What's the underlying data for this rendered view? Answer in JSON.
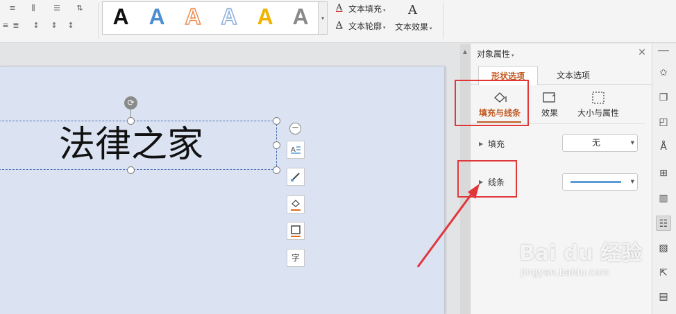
{
  "ribbon": {
    "text_styles": [
      {
        "glyph": "A",
        "name": "text-style-black",
        "color": "#111111"
      },
      {
        "glyph": "A",
        "name": "text-style-blue",
        "color": "#4f8fd1"
      },
      {
        "glyph": "A",
        "name": "text-style-orange-outline",
        "color": "#ee8a4a"
      },
      {
        "glyph": "A",
        "name": "text-style-blue-outline",
        "color": "#8aaedb"
      },
      {
        "glyph": "A",
        "name": "text-style-gold",
        "color": "#f0b400"
      },
      {
        "glyph": "A",
        "name": "text-style-gray-gradient",
        "color": "#8a8a8a"
      }
    ],
    "text_fill_label": "文本填充",
    "text_outline_label": "文本轮廓",
    "text_effect_label": "文本效果",
    "text_fill_glyph": "A",
    "text_outline_glyph": "A",
    "text_effect_glyph": "A"
  },
  "slide": {
    "textbox_text": "法律之家"
  },
  "floating_toolbar": {
    "minus": "−",
    "text_glyph": "字"
  },
  "panel": {
    "title": "对象属性",
    "close": "✕",
    "tabs": [
      {
        "label": "形状选项",
        "active": true
      },
      {
        "label": "文本选项",
        "active": false
      }
    ],
    "subtabs": [
      {
        "label": "填充与线条",
        "active": true,
        "icon": "fill-bucket-icon"
      },
      {
        "label": "效果",
        "active": false,
        "icon": "effect-icon"
      },
      {
        "label": "大小与属性",
        "active": false,
        "icon": "size-icon"
      }
    ],
    "fill": {
      "label": "填充",
      "value": "无"
    },
    "line": {
      "label": "线条"
    }
  },
  "watermark": {
    "main": "Bai du 经验",
    "sub": "jingyan.baidu.com"
  },
  "colors": {
    "accent": "#c15a22",
    "annotation_red": "#e0373a",
    "line_preview": "#5b9bd5"
  }
}
